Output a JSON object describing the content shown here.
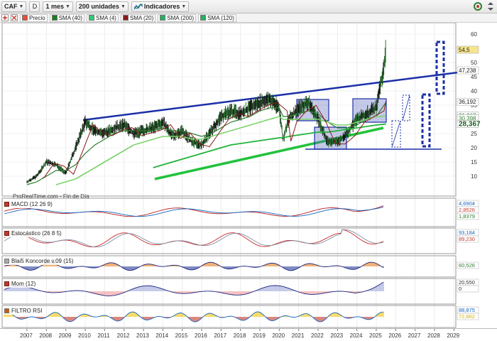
{
  "toolbar": {
    "symbol": "CAF",
    "type_label": "D",
    "period": "1 mes",
    "units": "200 unidades",
    "indicators_label": "Indicadores"
  },
  "legend": {
    "items": [
      {
        "label": "Precio",
        "color": "#e74c3c"
      },
      {
        "label": "SMA (40)",
        "color": "#1e7d1e"
      },
      {
        "label": "SMA (4)",
        "color": "#2ecc71"
      },
      {
        "label": "SMA (20)",
        "color": "#8b1a1a"
      },
      {
        "label": "SMA (200)",
        "color": "#27ae60"
      },
      {
        "label": "SMA (120)",
        "color": "#27ae60"
      }
    ]
  },
  "watermark": "ProRealTime.com - Fin de Día",
  "price_axis": {
    "ticks": [
      "60",
      "55",
      "50",
      "45",
      "40",
      "35",
      "30",
      "25",
      "20",
      "15",
      "10"
    ],
    "labels": [
      {
        "text": "54,5",
        "bg": "#f6e58d",
        "fg": "#222"
      },
      {
        "text": "47,238",
        "bg": "#ffffff",
        "fg": "#222"
      },
      {
        "text": "36,192",
        "bg": "#ffffff",
        "fg": "#222"
      },
      {
        "text": "31,367",
        "bg": "#ffffff",
        "fg": "#2e7d32"
      },
      {
        "text": "30,398",
        "bg": "#ffffff",
        "fg": "#2e7d32"
      },
      {
        "text": "28,367",
        "bg": "#ffffff",
        "fg": "#1b5e20"
      }
    ]
  },
  "panels": {
    "macd": {
      "label": "MACD (12 26 9)",
      "values": [
        "4,6904",
        "2,8526",
        "1,8379"
      ]
    },
    "stoch": {
      "label": "Estocástico (26 8 5)",
      "values": [
        "93,184",
        "89,230"
      ]
    },
    "blai": {
      "label": "Blai5 Koncorde v.09 (15)",
      "values": [
        "60,526"
      ]
    },
    "mom": {
      "label": "Mom (12)",
      "values": [
        "20,550",
        "0"
      ]
    },
    "rsi": {
      "label": "FILTRO RSI",
      "values": [
        "88,875",
        "72,862"
      ]
    }
  },
  "x_axis": {
    "years": [
      "2007",
      "2008",
      "2009",
      "2010",
      "2011",
      "2012",
      "2013",
      "2014",
      "2015",
      "2016",
      "2017",
      "2018",
      "2019",
      "2020",
      "2021",
      "2022",
      "2023",
      "2024",
      "2025",
      "2026",
      "2027",
      "2028",
      "2029"
    ]
  },
  "chart_data": {
    "type": "line",
    "title": "",
    "xlabel": "",
    "ylabel": "",
    "ylim": [
      5,
      62
    ],
    "x": [
      2007.0,
      2007.5,
      2008.0,
      2008.5,
      2009.0,
      2009.5,
      2010.0,
      2010.5,
      2011.0,
      2011.5,
      2012.0,
      2012.5,
      2013.0,
      2013.5,
      2014.0,
      2014.5,
      2015.0,
      2015.5,
      2016.0,
      2016.5,
      2017.0,
      2017.5,
      2018.0,
      2018.5,
      2019.0,
      2019.5,
      2020.0,
      2020.2,
      2020.5,
      2021.0,
      2021.5,
      2022.0,
      2022.5,
      2023.0,
      2023.5,
      2024.0,
      2024.5,
      2025.0,
      2025.3,
      2025.5
    ],
    "series": [
      {
        "name": "Precio",
        "values": [
          8,
          10,
          15,
          14,
          11,
          20,
          29,
          26,
          25,
          27,
          28,
          25,
          26,
          27,
          29,
          24,
          26,
          22,
          21,
          26,
          31,
          33,
          32,
          34,
          36,
          37,
          34,
          23,
          30,
          34,
          36,
          30,
          22,
          22,
          25,
          30,
          32,
          34,
          45,
          54.5
        ]
      },
      {
        "name": "SMA (40)",
        "values": [
          7,
          8,
          10,
          12,
          12,
          14,
          18,
          21,
          23,
          25,
          26,
          26,
          26,
          26,
          27,
          26,
          26,
          25,
          24,
          25,
          27,
          29,
          30,
          31,
          33,
          34,
          34,
          31,
          31,
          32,
          33,
          32,
          29,
          27,
          27,
          28,
          30,
          31,
          34,
          36
        ]
      },
      {
        "name": "SMA (200)",
        "values": [
          null,
          null,
          null,
          7,
          8,
          9,
          11,
          13,
          15,
          17,
          19,
          21,
          22,
          23,
          24,
          24,
          24,
          23,
          23,
          24,
          25,
          26,
          27,
          28,
          29,
          30,
          31,
          30,
          30,
          30,
          30,
          30,
          29,
          28,
          28,
          29,
          30,
          31,
          31,
          31.4
        ]
      },
      {
        "name": "SMA (120)",
        "values": [
          null,
          null,
          null,
          null,
          null,
          null,
          null,
          null,
          null,
          null,
          null,
          null,
          null,
          13,
          14,
          15,
          16,
          17,
          18,
          19,
          20,
          21,
          21.5,
          22,
          22.5,
          23,
          23.5,
          23.5,
          24,
          24.5,
          25,
          25.5,
          25.5,
          26,
          26.5,
          27,
          27.5,
          28,
          28.2,
          28.4
        ]
      }
    ]
  }
}
